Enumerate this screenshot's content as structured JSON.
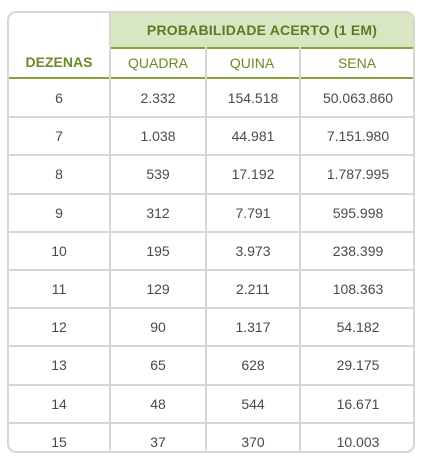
{
  "table": {
    "group_header": "PROBABILIDADE ACERTO (1 EM)",
    "columns": {
      "dezenas": "DEZENAS",
      "quadra": "QUADRA",
      "quina": "QUINA",
      "sena": "SENA"
    },
    "rows": [
      {
        "dezenas": "6",
        "quadra": "2.332",
        "quina": "154.518",
        "sena": "50.063.860"
      },
      {
        "dezenas": "7",
        "quadra": "1.038",
        "quina": "44.981",
        "sena": "7.151.980"
      },
      {
        "dezenas": "8",
        "quadra": "539",
        "quina": "17.192",
        "sena": "1.787.995"
      },
      {
        "dezenas": "9",
        "quadra": "312",
        "quina": "7.791",
        "sena": "595.998"
      },
      {
        "dezenas": "10",
        "quadra": "195",
        "quina": "3.973",
        "sena": "238.399"
      },
      {
        "dezenas": "11",
        "quadra": "129",
        "quina": "2.211",
        "sena": "108.363"
      },
      {
        "dezenas": "12",
        "quadra": "90",
        "quina": "1.317",
        "sena": "54.182"
      },
      {
        "dezenas": "13",
        "quadra": "65",
        "quina": "628",
        "sena": "29.175"
      },
      {
        "dezenas": "14",
        "quadra": "48",
        "quina": "544",
        "sena": "16.671"
      },
      {
        "dezenas": "15",
        "quadra": "37",
        "quina": "370",
        "sena": "10.003"
      }
    ]
  },
  "colors": {
    "header_bg": "#d9e6c4",
    "header_text": "#5d7a1f",
    "accent_rule": "#86a43a",
    "grid": "#d5d8d2",
    "body_text": "#4a4a4a"
  }
}
